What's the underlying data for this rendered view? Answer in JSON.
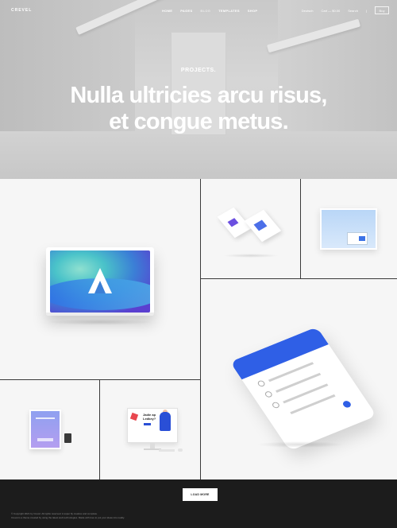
{
  "nav": {
    "logo": "CREVEL",
    "menu": [
      "HOME",
      "PAGES",
      "BLOG",
      "TEMPLATES",
      "SHOP"
    ],
    "right": {
      "language": "Deutsch",
      "cart": "Cart — $0.00",
      "search": "Search",
      "buy": "Buy"
    }
  },
  "hero": {
    "kicker": "PROJECTS.",
    "title_line1": "Nulla ultricies arcu risus,",
    "title_line2": "et congue metus."
  },
  "projects": {
    "desktop_heading_line1": "Jadie ap",
    "desktop_heading_line2": "Ledkey?"
  },
  "footer": {
    "load_more": "LOAD MORE",
    "copyright_line1": "© Copyright 2021 by Crevel. All rights reserved. A super fly creative and complete.",
    "copyright_line2": "Crevel is a theme created by using the latest web technologies. Made with love to put your ideas into reality."
  },
  "colors": {
    "accent_blue": "#2f5fe6",
    "footer_bg": "#1c1c1c",
    "grid_line": "#3a3a3a"
  }
}
